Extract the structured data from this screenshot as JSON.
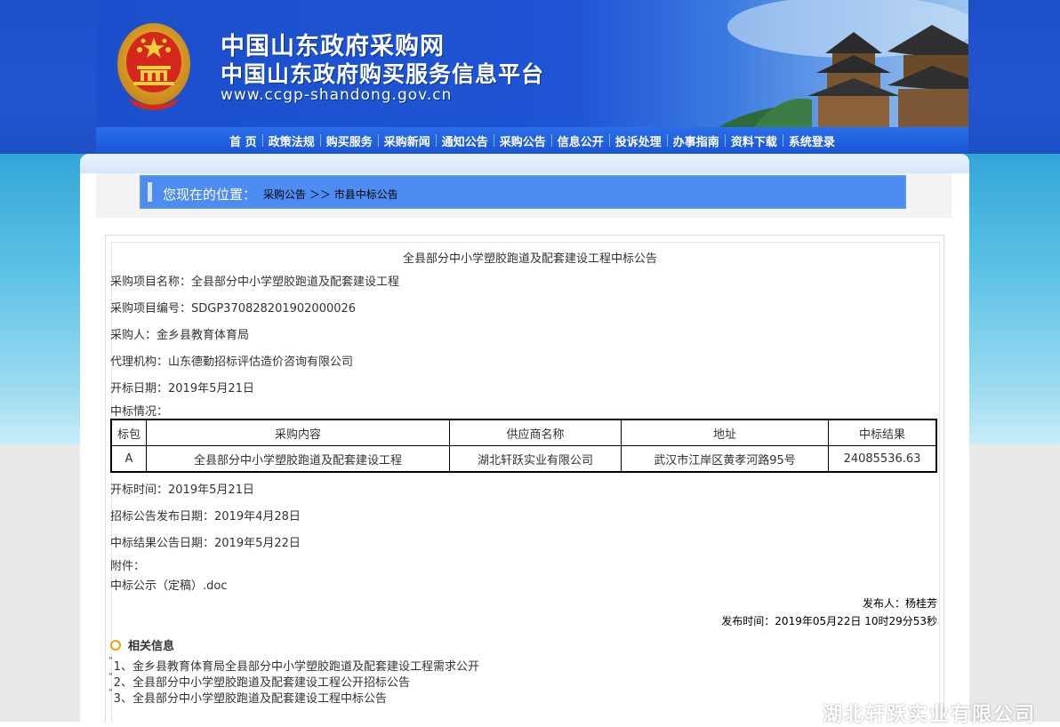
{
  "header": {
    "title_line1": "中国山东政府采购网",
    "title_line2": "中国山东政府购买服务信息平台",
    "url": "www.ccgp-shandong.gov.cn"
  },
  "nav": {
    "items": [
      "首 页",
      "政策法规",
      "购买服务",
      "采购新闻",
      "通知公告",
      "采购公告",
      "信息公开",
      "投诉处理",
      "办事指南",
      "资料下载",
      "系统登录"
    ]
  },
  "location": {
    "label": "您现在的位置：",
    "crumb_1": "采购公告",
    "separator": "＞＞",
    "crumb_2": "市县中标公告"
  },
  "notice": {
    "title": "全县部分中小学塑胶跑道及配套建设工程中标公告",
    "project_name": "采购项目名称：全县部分中小学塑胶跑道及配套建设工程",
    "project_code": "采购项目编号：SDGP370828201902000026",
    "purchaser": "采购人：金乡县教育体育局",
    "agency": "代理机构：山东德勤招标评估造价咨询有限公司",
    "bid_open_date": "开标日期：2019年5月21日",
    "award_heading": "中标情况：",
    "table": {
      "headers": [
        "标包",
        "采购内容",
        "供应商名称",
        "地址",
        "中标结果"
      ],
      "rows": [
        [
          "A",
          "全县部分中小学塑胶跑道及配套建设工程",
          "湖北轩跃实业有限公司",
          "武汉市江岸区黄孝河路95号",
          "24085536.63"
        ]
      ]
    },
    "bid_open_time": "开标时间：2019年5月21日",
    "tender_publish_date": "招标公告发布日期：2019年4月28日",
    "result_publish_date": "中标结果公告日期：2019年5月22日",
    "attachment_heading": "附件：",
    "attachment_file": "中标公示（定稿）.doc",
    "publisher": "发布人：杨桂芳",
    "publish_time": "发布时间：2019年05月22日 10时29分53秒"
  },
  "related": {
    "title": "相关信息",
    "items": [
      "1、金乡县教育体育局全县部分中小学塑胶跑道及配套建设工程需求公开",
      "2、全县部分中小学塑胶跑道及配套建设工程公开招标公告",
      "3、全县部分中小学塑胶跑道及配套建设工程中标公告"
    ]
  },
  "watermark": "湖北轩跃实业有限公司",
  "colors": {
    "header_blue": "#1f55d4",
    "location_bar": "#4d8cf0",
    "bullet_orange": "#f0a000"
  }
}
